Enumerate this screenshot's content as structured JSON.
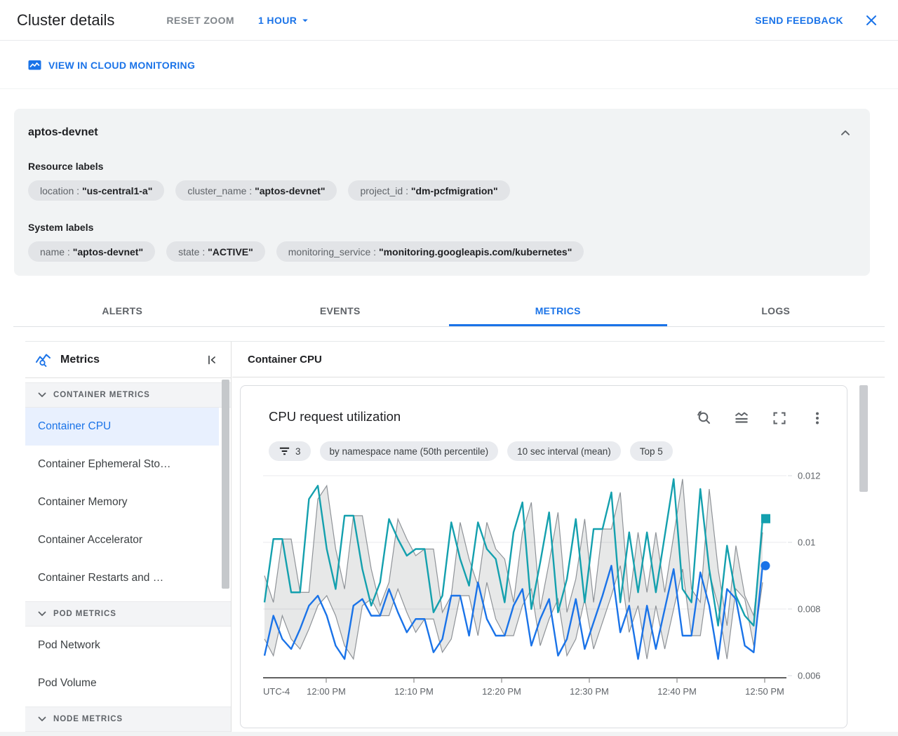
{
  "header": {
    "title": "Cluster details",
    "reset_zoom_label": "RESET ZOOM",
    "time_range_label": "1 HOUR",
    "send_feedback_label": "SEND FEEDBACK"
  },
  "monitoring_link_label": "VIEW IN CLOUD MONITORING",
  "label_separator": " : ",
  "cluster": {
    "name": "aptos-devnet",
    "resource_labels_title": "Resource labels",
    "resource_labels": [
      {
        "key": "location",
        "value": "\"us-central1-a\""
      },
      {
        "key": "cluster_name",
        "value": "\"aptos-devnet\""
      },
      {
        "key": "project_id",
        "value": "\"dm-pcfmigration\""
      }
    ],
    "system_labels_title": "System labels",
    "system_labels": [
      {
        "key": "name",
        "value": "\"aptos-devnet\""
      },
      {
        "key": "state",
        "value": "\"ACTIVE\""
      },
      {
        "key": "monitoring_service",
        "value": "\"monitoring.googleapis.com/kubernetes\""
      }
    ]
  },
  "tabs": [
    {
      "label": "ALERTS",
      "active": false
    },
    {
      "label": "EVENTS",
      "active": false
    },
    {
      "label": "METRICS",
      "active": true
    },
    {
      "label": "LOGS",
      "active": false
    }
  ],
  "sidebar": {
    "title": "Metrics",
    "sections": [
      {
        "header": "CONTAINER METRICS",
        "items": [
          {
            "label": "Container CPU",
            "selected": true
          },
          {
            "label": "Container Ephemeral Sto…",
            "selected": false
          },
          {
            "label": "Container Memory",
            "selected": false
          },
          {
            "label": "Container Accelerator",
            "selected": false
          },
          {
            "label": "Container Restarts and …",
            "selected": false
          }
        ]
      },
      {
        "header": "POD METRICS",
        "items": [
          {
            "label": "Pod Network",
            "selected": false
          },
          {
            "label": "Pod Volume",
            "selected": false
          }
        ]
      },
      {
        "header": "NODE METRICS",
        "items": []
      }
    ]
  },
  "chart_panel_title": "Container CPU",
  "chart_data": {
    "type": "line",
    "title": "CPU request utilization",
    "filters": [
      {
        "icon": "filter-list-icon",
        "label": "3"
      },
      {
        "label": "by namespace name (50th percentile)"
      },
      {
        "label": "10 sec interval (mean)"
      },
      {
        "label": "Top 5"
      }
    ],
    "ylim": [
      0.006,
      0.012
    ],
    "grid": true,
    "legend_position": "none",
    "x_axis": {
      "utc_label": "UTC-4",
      "ticks": [
        "12:00 PM",
        "12:10 PM",
        "12:20 PM",
        "12:30 PM",
        "12:40 PM",
        "12:50 PM"
      ]
    },
    "y_axis": {
      "ticks": [
        0.012,
        0.01,
        0.008,
        0.006
      ],
      "labels": [
        "0.012",
        "0.01",
        "0.008",
        "0.006"
      ]
    },
    "series": [
      {
        "name": "teal-series",
        "type": "line",
        "color": "#14a0ae",
        "marker": "square",
        "values": [
          0.0082,
          0.0101,
          0.0101,
          0.0085,
          0.0085,
          0.0113,
          0.0117,
          0.0098,
          0.0086,
          0.0108,
          0.0108,
          0.0092,
          0.0081,
          0.0088,
          0.0107,
          0.0101,
          0.0096,
          0.0098,
          0.0098,
          0.0079,
          0.0084,
          0.0106,
          0.0095,
          0.0087,
          0.0106,
          0.0098,
          0.0095,
          0.0082,
          0.0103,
          0.0112,
          0.008,
          0.0094,
          0.0109,
          0.0079,
          0.0089,
          0.0107,
          0.0082,
          0.0104,
          0.0104,
          0.0115,
          0.0082,
          0.0103,
          0.0085,
          0.0103,
          0.0085,
          0.0102,
          0.0119,
          0.0086,
          0.0082,
          0.0116,
          0.0092,
          0.0075,
          0.0099,
          0.0084,
          0.0078,
          0.0075,
          0.0107
        ]
      },
      {
        "name": "blue-series",
        "type": "line",
        "color": "#1a73e8",
        "marker": "circle",
        "values": [
          0.0066,
          0.0078,
          0.0071,
          0.0068,
          0.0074,
          0.0081,
          0.0084,
          0.0078,
          0.0069,
          0.0065,
          0.0081,
          0.0083,
          0.0078,
          0.0078,
          0.0086,
          0.0079,
          0.0073,
          0.0077,
          0.0077,
          0.0067,
          0.0071,
          0.0084,
          0.0084,
          0.0072,
          0.0088,
          0.0077,
          0.0072,
          0.0072,
          0.0081,
          0.0086,
          0.0069,
          0.0077,
          0.0083,
          0.0066,
          0.0071,
          0.0083,
          0.0068,
          0.0076,
          0.0084,
          0.0093,
          0.0073,
          0.0081,
          0.0065,
          0.0081,
          0.0068,
          0.008,
          0.0092,
          0.0072,
          0.0072,
          0.0091,
          0.0081,
          0.0065,
          0.0086,
          0.0083,
          0.0069,
          0.0067,
          0.0093
        ]
      },
      {
        "name": "gray-band",
        "type": "band",
        "color": "#8f9398",
        "upper": [
          0.009,
          0.0082,
          0.0101,
          0.0101,
          0.0085,
          0.0085,
          0.0113,
          0.0117,
          0.0098,
          0.0086,
          0.0108,
          0.0108,
          0.0092,
          0.0081,
          0.0088,
          0.0107,
          0.0101,
          0.0096,
          0.0098,
          0.0098,
          0.0079,
          0.0084,
          0.0106,
          0.0095,
          0.0087,
          0.0106,
          0.0098,
          0.0095,
          0.0082,
          0.0103,
          0.0112,
          0.008,
          0.0094,
          0.0109,
          0.0079,
          0.0089,
          0.0107,
          0.0082,
          0.0104,
          0.0104,
          0.0115,
          0.0082,
          0.0103,
          0.0085,
          0.0103,
          0.0085,
          0.0102,
          0.0119,
          0.0086,
          0.0082,
          0.0116,
          0.0092,
          0.0075,
          0.0099,
          0.0084,
          0.0078,
          0.0103
        ],
        "lower": [
          0.0071,
          0.0066,
          0.0078,
          0.0071,
          0.0068,
          0.0074,
          0.0081,
          0.0084,
          0.0078,
          0.0069,
          0.0065,
          0.0081,
          0.0083,
          0.0078,
          0.0078,
          0.0086,
          0.0079,
          0.0073,
          0.0077,
          0.0077,
          0.0067,
          0.0071,
          0.0084,
          0.0084,
          0.0072,
          0.0088,
          0.0077,
          0.0072,
          0.0072,
          0.0081,
          0.0086,
          0.0069,
          0.0077,
          0.0083,
          0.0066,
          0.0071,
          0.0083,
          0.0068,
          0.0076,
          0.0084,
          0.0093,
          0.0073,
          0.0081,
          0.0065,
          0.0081,
          0.0068,
          0.008,
          0.0092,
          0.0072,
          0.0072,
          0.0091,
          0.0081,
          0.0065,
          0.0086,
          0.0083,
          0.0069,
          0.0088
        ]
      }
    ]
  },
  "colors": {
    "accent": "#1a73e8",
    "teal_series": "#14a0ae",
    "blue_series": "#1a73e8",
    "band_gray": "#8f9398",
    "selected_item_bg": "#e8f0fe",
    "card_bg": "#f1f3f4"
  },
  "icons": {
    "close": "close-icon",
    "time_range_caret": "caret-down-icon",
    "monitoring": "area-chart-icon",
    "metrics_header": "line-chart-magnifier-icon",
    "collapse_panel": "collapse-left-icon",
    "section": "chevron-down-icon",
    "card_collapse": "chevron-up-icon",
    "filter": "filter-list-icon",
    "toolbar": [
      "zoom-reset-icon",
      "area-chart-icon",
      "fullscreen-icon",
      "more-vert-icon"
    ]
  }
}
